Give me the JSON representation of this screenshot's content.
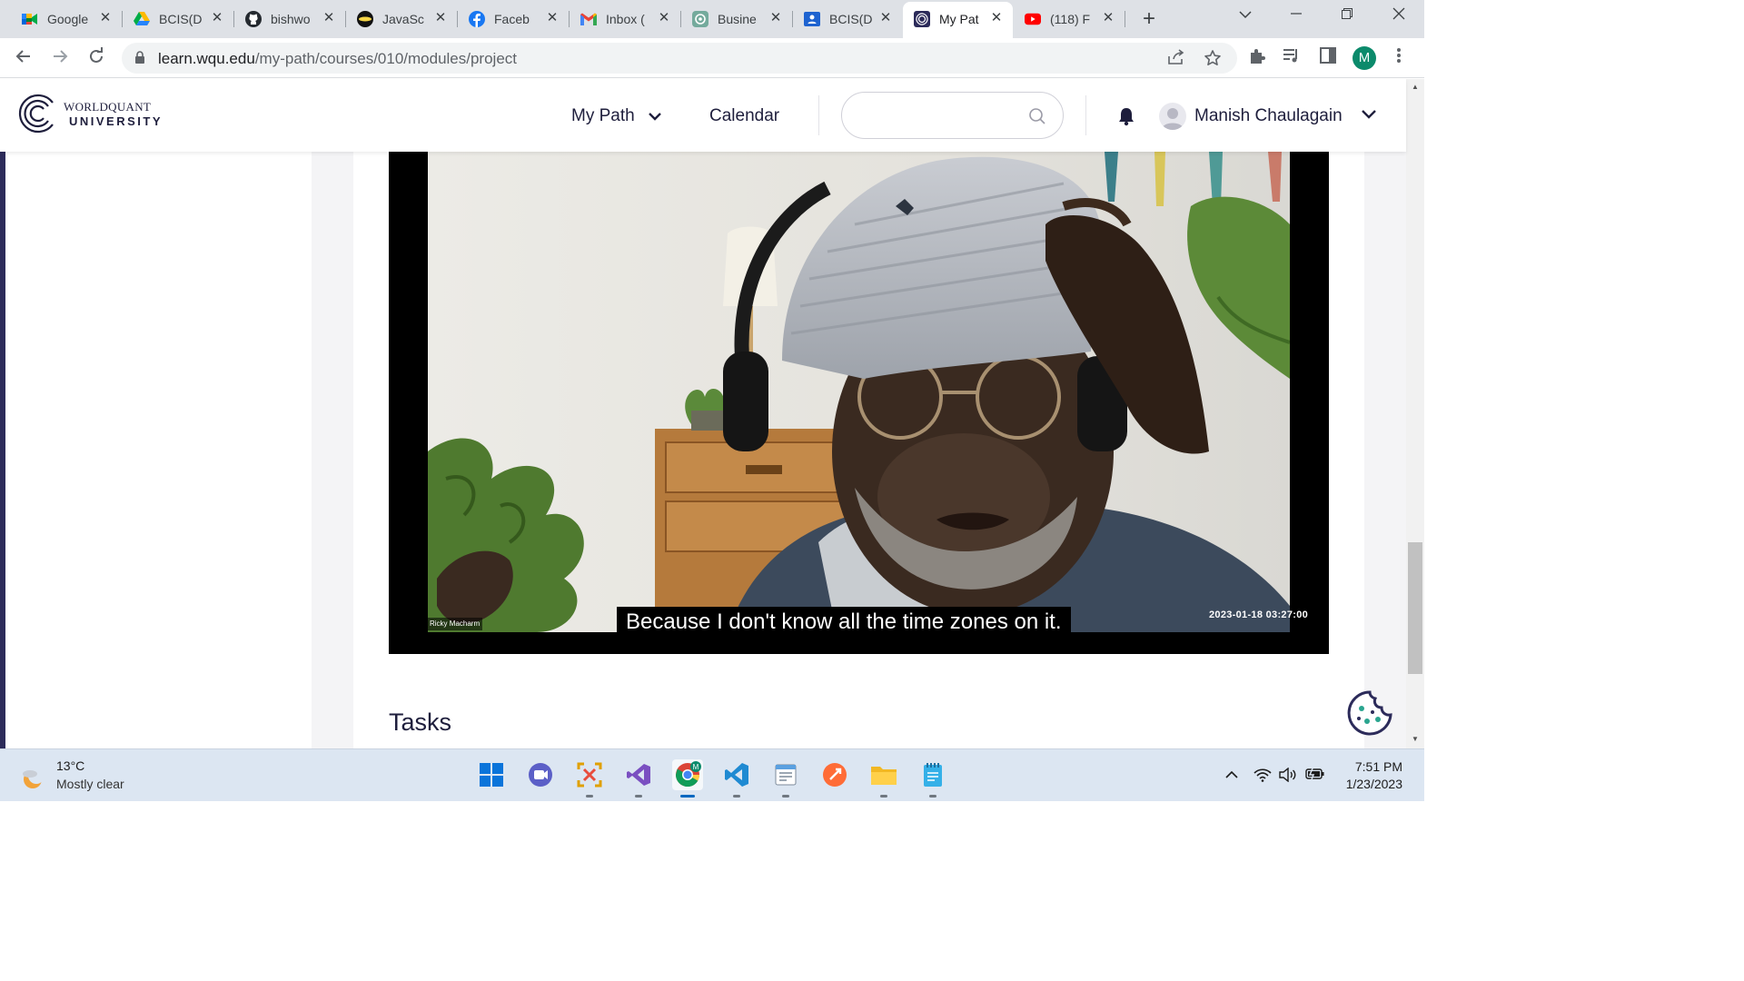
{
  "browser": {
    "tabs": [
      {
        "title": "Google",
        "icon": "google-meet-icon"
      },
      {
        "title": "BCIS(D",
        "icon": "google-drive-icon"
      },
      {
        "title": "bishwo",
        "icon": "github-icon"
      },
      {
        "title": "JavaSc",
        "icon": "javascript-site-icon"
      },
      {
        "title": "Faceb",
        "icon": "facebook-icon"
      },
      {
        "title": "Inbox (",
        "icon": "gmail-icon"
      },
      {
        "title": "Busine",
        "icon": "chatgpt-icon"
      },
      {
        "title": "BCIS(D",
        "icon": "google-classroom-icon"
      },
      {
        "title": "My Pat",
        "icon": "wqu-icon",
        "active": true
      },
      {
        "title": "(118) F",
        "icon": "youtube-icon"
      }
    ],
    "url_host": "learn.wqu.edu",
    "url_path": "/my-path/courses/010/modules/project",
    "profile_initial": "M"
  },
  "site": {
    "logo_line1": "WORLDQUANT",
    "logo_line2": "UNIVERSITY",
    "nav_my_path": "My Path",
    "nav_calendar": "Calendar",
    "search_placeholder": "",
    "user_name": "Manish Chaulagain"
  },
  "video": {
    "subtitle": "Because I don't know all the time zones on it.",
    "speaker_name": "Ricky Macharm",
    "timestamp": "2023-01-18  03:27:00"
  },
  "section": {
    "tasks_heading": "Tasks"
  },
  "taskbar": {
    "temperature": "13°C",
    "condition": "Mostly clear",
    "time": "7:51 PM",
    "date": "1/23/2023",
    "apps": [
      "windows-start-icon",
      "teams-chat-icon",
      "snipping-tool-icon",
      "visual-studio-icon",
      "chrome-icon",
      "vscode-icon",
      "notepad-app-icon",
      "postman-icon",
      "file-explorer-icon",
      "notepad-icon"
    ]
  },
  "colors": {
    "brand_navy": "#2c2b5a",
    "chrome_tabstrip": "#dee1e6",
    "taskbar": "#dce6f2"
  }
}
